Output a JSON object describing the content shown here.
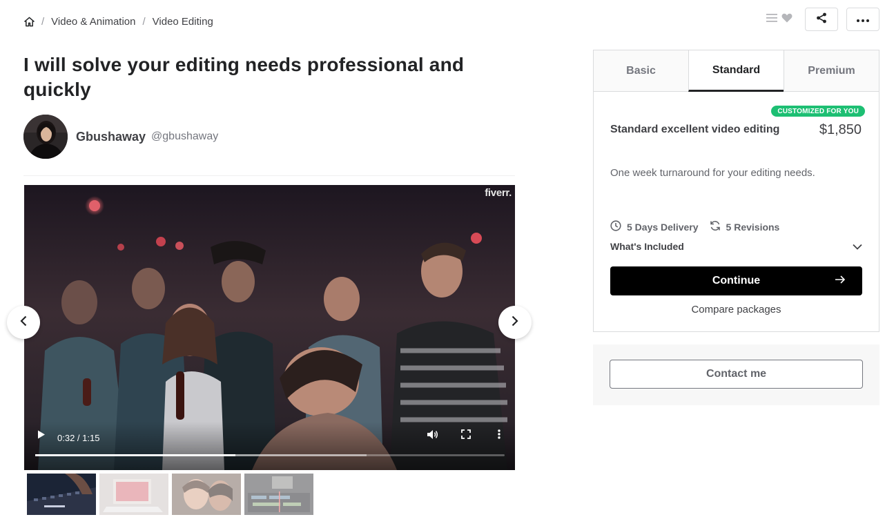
{
  "breadcrumb": {
    "home_icon": "home-icon",
    "separator": "/",
    "items": [
      "Video & Animation",
      "Video Editing"
    ]
  },
  "top_actions": {
    "icons": [
      "collections-icon",
      "heart-icon",
      "share-icon",
      "more-icon"
    ]
  },
  "gig": {
    "title": "I will solve your editing needs professional and quickly"
  },
  "seller": {
    "name": "Gbushaway",
    "handle": "@gbushaway"
  },
  "video": {
    "watermark": "fiverr.",
    "time": "0:32 / 1:15",
    "progress_fraction": 0.427,
    "buffered_fraction": 0.706
  },
  "packages": {
    "tabs": [
      "Basic",
      "Standard",
      "Premium"
    ],
    "active_tab": "Standard",
    "badge": "CUSTOMIZED FOR YOU",
    "title": "Standard excellent video editing",
    "price": "$1,850",
    "description": "One week turnaround for your editing needs.",
    "delivery": "5 Days Delivery",
    "revisions": "5 Revisions",
    "whats_included": "What's Included",
    "continue_label": "Continue",
    "compare_label": "Compare packages"
  },
  "contact": {
    "label": "Contact me"
  },
  "colors": {
    "badge_green": "#1dbf73",
    "continue_bg": "#000000",
    "text_dark": "#222325"
  }
}
